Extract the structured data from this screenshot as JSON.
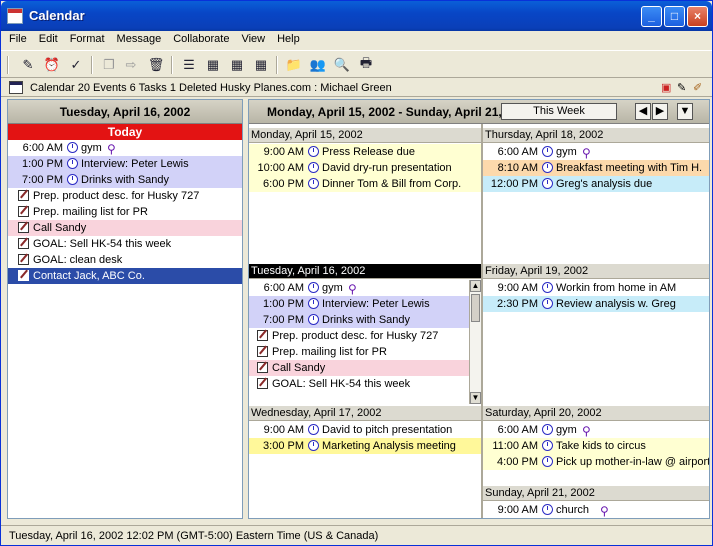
{
  "window": {
    "title": "Calendar"
  },
  "menu": [
    "File",
    "Edit",
    "Format",
    "Message",
    "Collaborate",
    "View",
    "Help"
  ],
  "info": {
    "text": "Calendar   20 Events  6 Tasks  1 Deleted   Husky Planes.com : Michael Green"
  },
  "left": {
    "header": "Tuesday, April 16, 2002",
    "today_label": "Today",
    "items": [
      {
        "kind": "event",
        "time": "6:00 AM",
        "label": "gym",
        "repeat": true,
        "bg": ""
      },
      {
        "kind": "event",
        "time": "1:00 PM",
        "label": "Interview: Peter Lewis",
        "repeat": false,
        "bg": "bg-blue"
      },
      {
        "kind": "event",
        "time": "7:00 PM",
        "label": "Drinks with Sandy",
        "repeat": false,
        "bg": "bg-blue"
      },
      {
        "kind": "task",
        "label": "Prep. product desc. for Husky 727",
        "bg": ""
      },
      {
        "kind": "task",
        "label": "Prep. mailing list for PR",
        "bg": ""
      },
      {
        "kind": "task",
        "label": "Call Sandy",
        "bg": "bg-pink"
      },
      {
        "kind": "task",
        "label": "GOAL: Sell HK-54 this week",
        "bg": ""
      },
      {
        "kind": "task",
        "label": "GOAL: clean desk",
        "bg": ""
      },
      {
        "kind": "task",
        "label": "Contact Jack, ABC Co.",
        "bg": "bg-sel"
      }
    ]
  },
  "week": {
    "title": "Monday, April 15, 2002 - Sunday, April 21,",
    "this_week_label": "This Week",
    "days": [
      {
        "name": "Monday, April 15, 2002",
        "items": [
          {
            "kind": "event",
            "time": "9:00 AM",
            "label": "Press Release due",
            "repeat": false,
            "bg": "bg-yellow"
          },
          {
            "kind": "event",
            "time": "10:00 AM",
            "label": "David dry-run presentation",
            "repeat": false,
            "bg": "bg-yellow"
          },
          {
            "kind": "event",
            "time": "6:00 PM",
            "label": "Dinner Tom & Bill from Corp.",
            "repeat": false,
            "bg": "bg-yellow"
          }
        ]
      },
      {
        "name": "Thursday, April 18, 2002",
        "items": [
          {
            "kind": "event",
            "time": "6:00 AM",
            "label": "gym",
            "repeat": true,
            "bg": ""
          },
          {
            "kind": "event",
            "time": "8:10 AM",
            "label": "Breakfast meeting with Tim H.",
            "repeat": false,
            "bg": "bg-orange"
          },
          {
            "kind": "event",
            "time": "12:00 PM",
            "label": "Greg's analysis due",
            "repeat": false,
            "bg": "bg-cyan"
          }
        ]
      },
      {
        "name": "Tuesday, April 16, 2002",
        "items": [
          {
            "kind": "event",
            "time": "6:00 AM",
            "label": "gym",
            "repeat": true,
            "bg": ""
          },
          {
            "kind": "event",
            "time": "1:00 PM",
            "label": "Interview: Peter Lewis",
            "repeat": false,
            "bg": "bg-blue"
          },
          {
            "kind": "event",
            "time": "7:00 PM",
            "label": "Drinks with Sandy",
            "repeat": false,
            "bg": "bg-blue"
          },
          {
            "kind": "task",
            "label": "Prep. product desc. for Husky 727",
            "bg": ""
          },
          {
            "kind": "task",
            "label": "Prep. mailing list for PR",
            "bg": ""
          },
          {
            "kind": "task",
            "label": "Call Sandy",
            "bg": "bg-pink"
          },
          {
            "kind": "task",
            "label": "GOAL: Sell HK-54 this week",
            "bg": ""
          }
        ]
      },
      {
        "name": "Friday, April 19, 2002",
        "items": [
          {
            "kind": "event",
            "time": "9:00 AM",
            "label": "Workin from home in AM",
            "repeat": false,
            "bg": ""
          },
          {
            "kind": "event",
            "time": "2:30 PM",
            "label": "Review analysis w. Greg",
            "repeat": false,
            "bg": "bg-cyan"
          }
        ]
      },
      {
        "name": "Wednesday, April 17, 2002",
        "items": [
          {
            "kind": "event",
            "time": "9:00 AM",
            "label": "David to pitch presentation",
            "repeat": false,
            "bg": ""
          },
          {
            "kind": "event",
            "time": "3:00 PM",
            "label": "Marketing Analysis meeting",
            "repeat": false,
            "bg": "bg-yellow2"
          }
        ]
      },
      {
        "name": "Saturday, April 20, 2002",
        "items": [
          {
            "kind": "event",
            "time": "6:00 AM",
            "label": "gym",
            "repeat": true,
            "bg": ""
          },
          {
            "kind": "event",
            "time": "11:00 AM",
            "label": "Take kids to circus",
            "repeat": false,
            "bg": "bg-yellow"
          },
          {
            "kind": "event",
            "time": "4:00 PM",
            "label": "Pick up mother-in-law @ airport",
            "repeat": false,
            "bg": "bg-yellow"
          }
        ]
      },
      {
        "name": "Sunday, April 21, 2002",
        "items": [
          {
            "kind": "event",
            "time": "9:00 AM",
            "label": "church",
            "repeat": true,
            "bg": ""
          }
        ]
      }
    ]
  },
  "status": {
    "text": "Tuesday, April 16, 2002 12:02 PM (GMT-5:00) Eastern Time (US & Canada)"
  }
}
